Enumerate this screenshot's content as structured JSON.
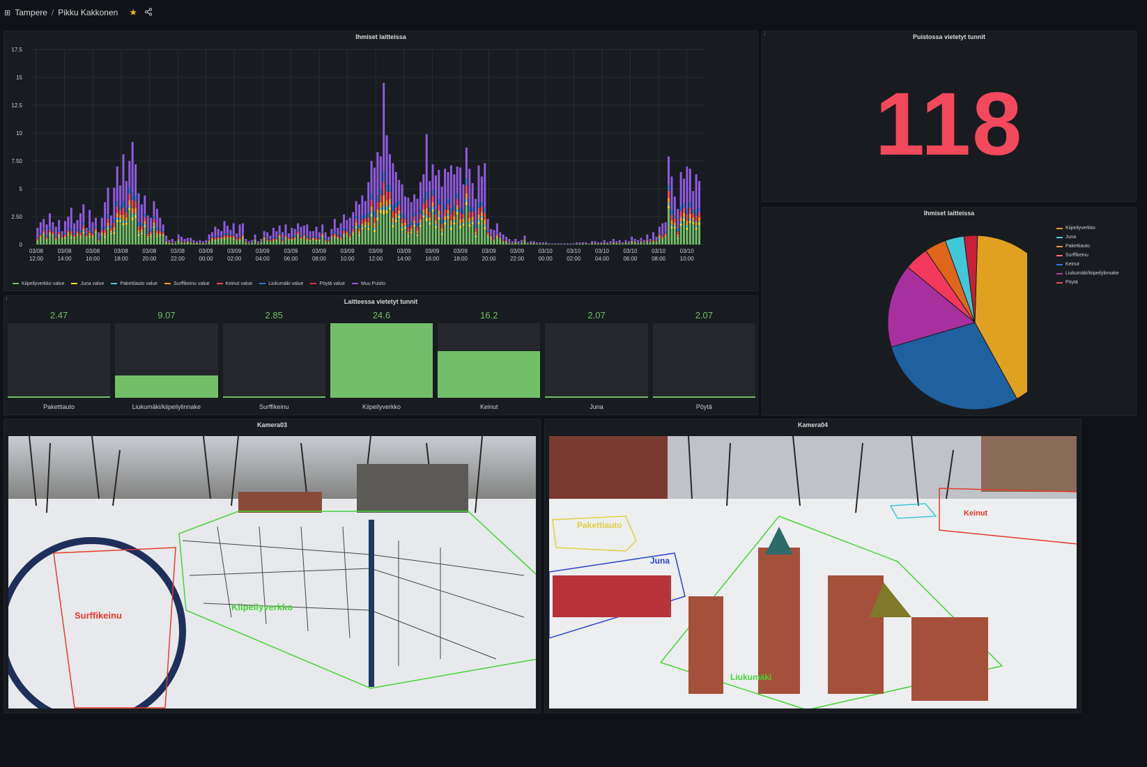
{
  "breadcrumb": {
    "folder": "Tampere",
    "separator": "/",
    "dashboard": "Pikku Kakkonen"
  },
  "panels": {
    "timeseries_title": "Ihmiset laitteissa",
    "stat_title": "Puistossa vietetyt tunnit",
    "stat_value": "118",
    "pie_title": "Ihmiset laitteissa",
    "bargauge_title": "Laitteessa vietetyt tunnit",
    "cam1_title": "Kamera03",
    "cam2_title": "Kamera04"
  },
  "colors": {
    "green": "#73bf69",
    "yellow": "#fade2a",
    "cyan": "#5ac8d8",
    "orange": "#ff9830",
    "red": "#f2495c",
    "blue": "#3274d9",
    "purple": "#8f5be0",
    "stat": "#f2495c"
  },
  "bargauge": [
    {
      "label": "Pakettiauto",
      "value": "2.47",
      "fraction": 0.0
    },
    {
      "label": "Liukumäki/kiipeilylinnake",
      "value": "9.07",
      "fraction": 0.3
    },
    {
      "label": "Surffikeinu",
      "value": "2.85",
      "fraction": 0.02
    },
    {
      "label": "Kiipeilyverkko",
      "value": "24.6",
      "fraction": 1.0
    },
    {
      "label": "Keinut",
      "value": "16.2",
      "fraction": 0.63
    },
    {
      "label": "Juna",
      "value": "2.07",
      "fraction": 0.0
    },
    {
      "label": "Pöytä",
      "value": "2.07",
      "fraction": 0.0
    }
  ],
  "pie_legend": [
    {
      "label": "Kiipeilyverkko",
      "color": "#e0a020"
    },
    {
      "label": "Juna",
      "color": "#5ac8d8"
    },
    {
      "label": "Pakettiauto",
      "color": "#ff9830"
    },
    {
      "label": "Surffikeinu",
      "color": "#ff7383"
    },
    {
      "label": "Keinut",
      "color": "#3274d9"
    },
    {
      "label": "Liukumäki/kiipeilylinnake",
      "color": "#b83fb0"
    },
    {
      "label": "Pöytä",
      "color": "#f2495c"
    }
  ],
  "ts_legend": [
    {
      "label": "Kiipeilyverkko value",
      "color": "#73bf69"
    },
    {
      "label": "Juna value",
      "color": "#fade2a"
    },
    {
      "label": "Pakettiauto value",
      "color": "#5ac8d8"
    },
    {
      "label": "Surffikeinu value",
      "color": "#ff9830"
    },
    {
      "label": "Keinut value",
      "color": "#f2495c"
    },
    {
      "label": "Liukumäki value",
      "color": "#3274d9"
    },
    {
      "label": "Pöytä value",
      "color": "#e02f44"
    },
    {
      "label": "Muu Puisto",
      "color": "#8f5be0"
    }
  ],
  "cam_labels": {
    "cam1": [
      "Surffikeinu",
      "Kiipeilyverkko"
    ],
    "cam2": [
      "Pakettiauto",
      "Juna",
      "Keinut",
      "Liukumäki"
    ]
  },
  "chart_data": {
    "type": "bar",
    "stacked": true,
    "title": "Ihmiset laitteissa",
    "ylim": [
      0,
      17.5
    ],
    "yticks": [
      "0",
      "2.50",
      "5",
      "7.50",
      "10",
      "12.5",
      "15",
      "17.5"
    ],
    "xticks": [
      [
        "03/08",
        "12:00"
      ],
      [
        "03/08",
        "14:00"
      ],
      [
        "03/08",
        "16:00"
      ],
      [
        "03/08",
        "18:00"
      ],
      [
        "03/08",
        "20:00"
      ],
      [
        "03/08",
        "22:00"
      ],
      [
        "03/09",
        "00:00"
      ],
      [
        "03/09",
        "02:00"
      ],
      [
        "03/09",
        "04:00"
      ],
      [
        "03/09",
        "06:00"
      ],
      [
        "03/09",
        "08:00"
      ],
      [
        "03/09",
        "10:00"
      ],
      [
        "03/09",
        "12:00"
      ],
      [
        "03/09",
        "14:00"
      ],
      [
        "03/09",
        "16:00"
      ],
      [
        "03/09",
        "18:00"
      ],
      [
        "03/09",
        "20:00"
      ],
      [
        "03/09",
        "22:00"
      ],
      [
        "03/10",
        "00:00"
      ],
      [
        "03/10",
        "02:00"
      ],
      [
        "03/10",
        "04:00"
      ],
      [
        "03/10",
        "06:00"
      ],
      [
        "03/10",
        "08:00"
      ],
      [
        "03/10",
        "10:00"
      ]
    ],
    "grid": true,
    "legend": "bottom",
    "totals": [
      1.5,
      2,
      2.3,
      1.8,
      2.8,
      2,
      1.6,
      2.2,
      1.2,
      2.1,
      2.5,
      3.3,
      1.9,
      2.2,
      2.8,
      3.6,
      1.5,
      3.1,
      2,
      2.4,
      1.1,
      2.4,
      3.8,
      5.1,
      2.6,
      5.1,
      7,
      5.3,
      8.1,
      5.7,
      7.5,
      9.2,
      7.2,
      4.6,
      3.6,
      4.4,
      2.6,
      2.4,
      3.9,
      3.2,
      2.4,
      1.8,
      0.8,
      0.4,
      0.5,
      0.3,
      0.9,
      0.7,
      0.5,
      0.6,
      0.6,
      0.4,
      0.3,
      0.4,
      0.3,
      0.4,
      0.9,
      1.1,
      1.6,
      1.4,
      1.2,
      2.1,
      1.7,
      1.3,
      1.9,
      1,
      1.8,
      1.9,
      0.5,
      0.3,
      0.4,
      0.9,
      0.3,
      0.5,
      1.2,
      1.1,
      0.8,
      1.5,
      1.2,
      1.7,
      1.1,
      1.8,
      1,
      1.5,
      1.4,
      1.9,
      1.6,
      1.7,
      1.8,
      1.2,
      1.2,
      1.6,
      1.1,
      1.8,
      1.1,
      0.7,
      1.4,
      2.3,
      1.5,
      1.9,
      2.7,
      2.2,
      2.4,
      2.9,
      3.9,
      3.6,
      4.4,
      3.9,
      5.6,
      7.5,
      6.9,
      8.3,
      7.9,
      14.5,
      9.8,
      8.1,
      7.3,
      6.5,
      5.8,
      5.4,
      4.3,
      4.2,
      3.8,
      4.5,
      4.1,
      5.6,
      6.3,
      9.9,
      5.7,
      7.2,
      6.2,
      6.7,
      5.2,
      6.8,
      6.5,
      7.1,
      6.3,
      7,
      6.9,
      5.4,
      8.7,
      6.8,
      5.5,
      4.1,
      7.1,
      6.1,
      7.3,
      2.3,
      1.4,
      1.3,
      1.9,
      1.1,
      0.9,
      0.7,
      0.5,
      0.3,
      0.5,
      0.3,
      0.4,
      0.8,
      0.2,
      0.3,
      0.3,
      0.2,
      0.2,
      0.2,
      0.2,
      0.1,
      0.1,
      0.1,
      0.1,
      0.1,
      0.1,
      0.1,
      0.1,
      0.1,
      0.2,
      0.2,
      0.2,
      0.2,
      0.1,
      0.3,
      0.3,
      0.2,
      0.2,
      0.4,
      0.2,
      0.3,
      0.5,
      0.3,
      0.4,
      0.2,
      0.4,
      0.3,
      0.7,
      0.5,
      0.4,
      0.6,
      0.4,
      0.9,
      0.5,
      1.1,
      0.7,
      1.6,
      1.9,
      2,
      7.9,
      6.1,
      4.3,
      3.2,
      6.5,
      5.9,
      7,
      6.8,
      4.8,
      6.3,
      5.7
    ]
  }
}
